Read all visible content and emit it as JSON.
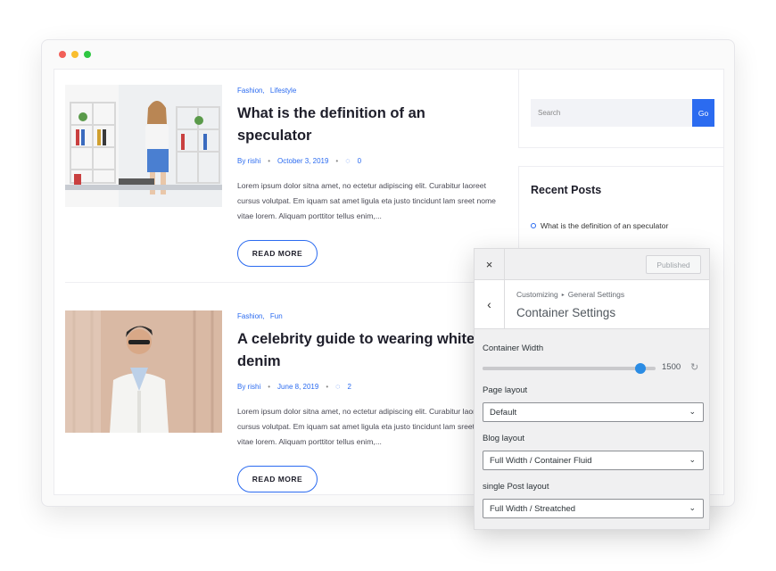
{
  "window": {
    "dot_colors": [
      "#f25f58",
      "#f9be2f",
      "#2ec742"
    ]
  },
  "posts": [
    {
      "categories": [
        "Fashion,",
        "Lifestyle"
      ],
      "title": "What is the definition of an speculator",
      "author": "By rishi",
      "date": "October 3, 2019",
      "comments": "0",
      "excerpt": "Lorem ipsum dolor sitna amet, no ectetur adipiscing elit. Curabitur laoreet cursus volutpat. Em iquam sat amet ligula eta justo tincidunt lam sreet nome vitae lorem. Aliquam porttitor tellus enim,...",
      "read_more": "READ MORE"
    },
    {
      "categories": [
        "Fashion,",
        "Fun"
      ],
      "title": "A celebrity guide to wearing white denim",
      "author": "By rishi",
      "date": "June 8, 2019",
      "comments": "2",
      "excerpt": "Lorem ipsum dolor sitna amet, no ectetur adipiscing elit. Curabitur laoreet cursus volutpat. Em iquam sat amet ligula eta justo tincidunt lam sreet nome vitae lorem. Aliquam porttitor tellus enim,...",
      "read_more": "READ MORE"
    }
  ],
  "sidebar": {
    "search_placeholder": "Search",
    "search_button": "Go",
    "recent_title": "Recent Posts",
    "recent_items": [
      "What is the definition of an speculator"
    ]
  },
  "customizer": {
    "close_icon": "×",
    "published_label": "Published",
    "back_icon": "‹",
    "breadcrumb": [
      "Customizing",
      "General Settings"
    ],
    "breadcrumb_separator": "▸",
    "panel_title": "Container Settings",
    "container_width_label": "Container Width",
    "container_width_value": "1500",
    "container_width_fraction": 0.91,
    "reset_icon": "↻",
    "page_layout_label": "Page layout",
    "page_layout_value": "Default",
    "blog_layout_label": "Blog layout",
    "blog_layout_value": "Full Width / Container Fluid",
    "single_post_layout_label": "single Post layout",
    "single_post_layout_value": "Full Width / Streatched",
    "chevron_icon": "⌄",
    "accent": "#2b8ce4"
  },
  "colors": {
    "brand_blue": "#2b6bf0"
  }
}
